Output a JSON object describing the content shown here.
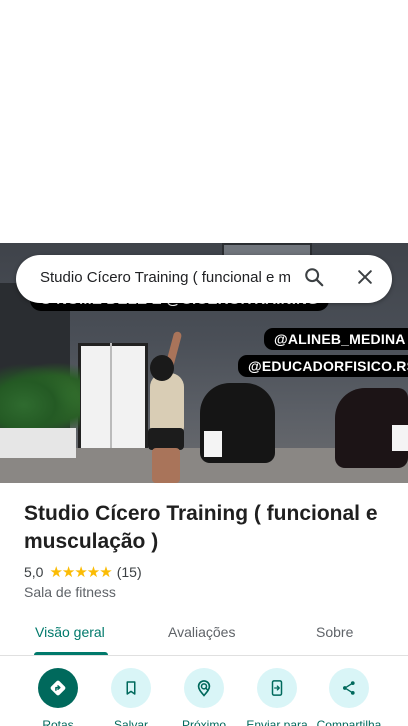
{
  "search": {
    "query": "Studio Cícero Training ( funcional e m",
    "search_icon": "search-icon",
    "close_icon": "close-icon"
  },
  "photo": {
    "caption_top": "O NOME DELE É @CICERO.TRAINING",
    "caption_handle_1": "@ALINEB_MEDINA",
    "caption_handle_2": "@EDUCADORFISICO.RS"
  },
  "place": {
    "title": "Studio Cícero Training ( funcional e musculação )",
    "rating": "5,0",
    "stars": "★★★★★",
    "review_count": "(15)",
    "category": "Sala de fitness"
  },
  "tabs": [
    {
      "label": "Visão geral",
      "active": true
    },
    {
      "label": "Avaliações",
      "active": false
    },
    {
      "label": "Sobre",
      "active": false
    }
  ],
  "actions": [
    {
      "label": "Rotas",
      "icon": "directions-icon"
    },
    {
      "label": "Salvar",
      "icon": "bookmark-icon"
    },
    {
      "label": "Próximo",
      "icon": "nearby-icon"
    },
    {
      "label": "Enviar para",
      "icon": "send-to-phone-icon"
    },
    {
      "label": "Compartilha",
      "icon": "share-icon"
    }
  ],
  "colors": {
    "accent": "#00796b",
    "action_circle": "#d9f5f7",
    "star": "#fbbc04"
  }
}
